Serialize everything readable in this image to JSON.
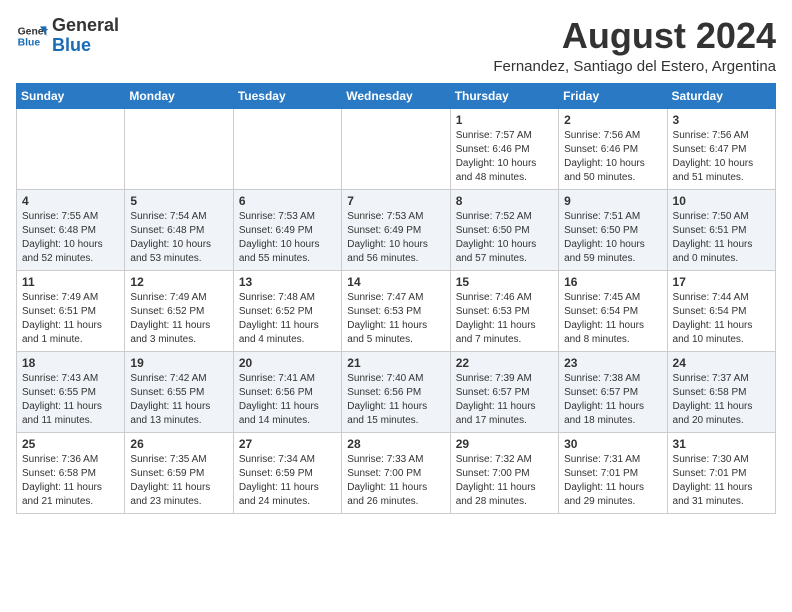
{
  "header": {
    "logo_general": "General",
    "logo_blue": "Blue",
    "month_year": "August 2024",
    "location": "Fernandez, Santiago del Estero, Argentina"
  },
  "days_of_week": [
    "Sunday",
    "Monday",
    "Tuesday",
    "Wednesday",
    "Thursday",
    "Friday",
    "Saturday"
  ],
  "weeks": [
    [
      {
        "day": "",
        "info": ""
      },
      {
        "day": "",
        "info": ""
      },
      {
        "day": "",
        "info": ""
      },
      {
        "day": "",
        "info": ""
      },
      {
        "day": "1",
        "info": "Sunrise: 7:57 AM\nSunset: 6:46 PM\nDaylight: 10 hours\nand 48 minutes."
      },
      {
        "day": "2",
        "info": "Sunrise: 7:56 AM\nSunset: 6:46 PM\nDaylight: 10 hours\nand 50 minutes."
      },
      {
        "day": "3",
        "info": "Sunrise: 7:56 AM\nSunset: 6:47 PM\nDaylight: 10 hours\nand 51 minutes."
      }
    ],
    [
      {
        "day": "4",
        "info": "Sunrise: 7:55 AM\nSunset: 6:48 PM\nDaylight: 10 hours\nand 52 minutes."
      },
      {
        "day": "5",
        "info": "Sunrise: 7:54 AM\nSunset: 6:48 PM\nDaylight: 10 hours\nand 53 minutes."
      },
      {
        "day": "6",
        "info": "Sunrise: 7:53 AM\nSunset: 6:49 PM\nDaylight: 10 hours\nand 55 minutes."
      },
      {
        "day": "7",
        "info": "Sunrise: 7:53 AM\nSunset: 6:49 PM\nDaylight: 10 hours\nand 56 minutes."
      },
      {
        "day": "8",
        "info": "Sunrise: 7:52 AM\nSunset: 6:50 PM\nDaylight: 10 hours\nand 57 minutes."
      },
      {
        "day": "9",
        "info": "Sunrise: 7:51 AM\nSunset: 6:50 PM\nDaylight: 10 hours\nand 59 minutes."
      },
      {
        "day": "10",
        "info": "Sunrise: 7:50 AM\nSunset: 6:51 PM\nDaylight: 11 hours\nand 0 minutes."
      }
    ],
    [
      {
        "day": "11",
        "info": "Sunrise: 7:49 AM\nSunset: 6:51 PM\nDaylight: 11 hours\nand 1 minute."
      },
      {
        "day": "12",
        "info": "Sunrise: 7:49 AM\nSunset: 6:52 PM\nDaylight: 11 hours\nand 3 minutes."
      },
      {
        "day": "13",
        "info": "Sunrise: 7:48 AM\nSunset: 6:52 PM\nDaylight: 11 hours\nand 4 minutes."
      },
      {
        "day": "14",
        "info": "Sunrise: 7:47 AM\nSunset: 6:53 PM\nDaylight: 11 hours\nand 5 minutes."
      },
      {
        "day": "15",
        "info": "Sunrise: 7:46 AM\nSunset: 6:53 PM\nDaylight: 11 hours\nand 7 minutes."
      },
      {
        "day": "16",
        "info": "Sunrise: 7:45 AM\nSunset: 6:54 PM\nDaylight: 11 hours\nand 8 minutes."
      },
      {
        "day": "17",
        "info": "Sunrise: 7:44 AM\nSunset: 6:54 PM\nDaylight: 11 hours\nand 10 minutes."
      }
    ],
    [
      {
        "day": "18",
        "info": "Sunrise: 7:43 AM\nSunset: 6:55 PM\nDaylight: 11 hours\nand 11 minutes."
      },
      {
        "day": "19",
        "info": "Sunrise: 7:42 AM\nSunset: 6:55 PM\nDaylight: 11 hours\nand 13 minutes."
      },
      {
        "day": "20",
        "info": "Sunrise: 7:41 AM\nSunset: 6:56 PM\nDaylight: 11 hours\nand 14 minutes."
      },
      {
        "day": "21",
        "info": "Sunrise: 7:40 AM\nSunset: 6:56 PM\nDaylight: 11 hours\nand 15 minutes."
      },
      {
        "day": "22",
        "info": "Sunrise: 7:39 AM\nSunset: 6:57 PM\nDaylight: 11 hours\nand 17 minutes."
      },
      {
        "day": "23",
        "info": "Sunrise: 7:38 AM\nSunset: 6:57 PM\nDaylight: 11 hours\nand 18 minutes."
      },
      {
        "day": "24",
        "info": "Sunrise: 7:37 AM\nSunset: 6:58 PM\nDaylight: 11 hours\nand 20 minutes."
      }
    ],
    [
      {
        "day": "25",
        "info": "Sunrise: 7:36 AM\nSunset: 6:58 PM\nDaylight: 11 hours\nand 21 minutes."
      },
      {
        "day": "26",
        "info": "Sunrise: 7:35 AM\nSunset: 6:59 PM\nDaylight: 11 hours\nand 23 minutes."
      },
      {
        "day": "27",
        "info": "Sunrise: 7:34 AM\nSunset: 6:59 PM\nDaylight: 11 hours\nand 24 minutes."
      },
      {
        "day": "28",
        "info": "Sunrise: 7:33 AM\nSunset: 7:00 PM\nDaylight: 11 hours\nand 26 minutes."
      },
      {
        "day": "29",
        "info": "Sunrise: 7:32 AM\nSunset: 7:00 PM\nDaylight: 11 hours\nand 28 minutes."
      },
      {
        "day": "30",
        "info": "Sunrise: 7:31 AM\nSunset: 7:01 PM\nDaylight: 11 hours\nand 29 minutes."
      },
      {
        "day": "31",
        "info": "Sunrise: 7:30 AM\nSunset: 7:01 PM\nDaylight: 11 hours\nand 31 minutes."
      }
    ]
  ]
}
